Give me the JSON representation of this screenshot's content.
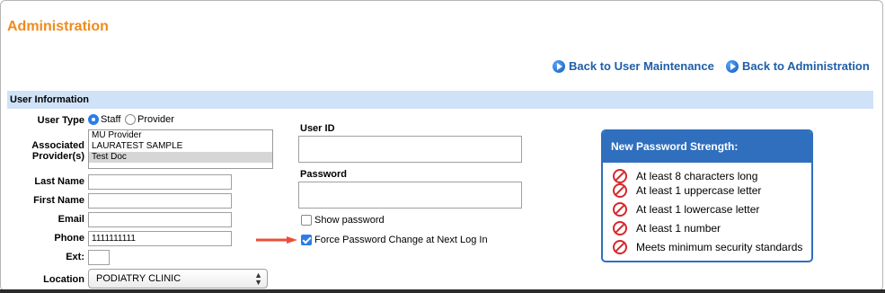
{
  "page": {
    "title": "Administration"
  },
  "nav": {
    "back_user_maintenance": "Back to User Maintenance",
    "back_administration": "Back to Administration"
  },
  "section": {
    "title": "User Information"
  },
  "form": {
    "user_type_label": "User Type",
    "user_type_options": [
      "Staff",
      "Provider"
    ],
    "user_type_selected": "Staff",
    "associated_providers_label": "Associated Provider(s)",
    "associated_providers": [
      "MU Provider",
      "LAURATEST SAMPLE",
      "Test Doc"
    ],
    "associated_provider_selected": "Test Doc",
    "last_name_label": "Last Name",
    "last_name_value": "",
    "first_name_label": "First Name",
    "first_name_value": "",
    "email_label": "Email",
    "email_value": "",
    "phone_label": "Phone",
    "phone_value": "1111111111",
    "ext_label": "Ext:",
    "ext_value": "",
    "location_label": "Location",
    "location_value": "PODIATRY CLINIC",
    "user_id_label": "User ID",
    "user_id_value": "",
    "password_label": "Password",
    "password_value": "",
    "show_password_label": "Show password",
    "show_password_checked": false,
    "force_change_label": "Force Password Change at Next Log In",
    "force_change_checked": true
  },
  "password_strength": {
    "title": "New Password Strength:",
    "rules": [
      "At least 8 characters long",
      "At least 1 uppercase letter",
      "At least 1 lowercase letter",
      "At least 1 number",
      "Meets minimum security standards"
    ],
    "status_icon": "prohibited-icon",
    "status_color": "#d7262b"
  },
  "colors": {
    "title": "#f08a1c",
    "link": "#1f5fa8",
    "section_bar": "#cfe2f7",
    "accent": "#2f6fbd",
    "annotation_arrow": "#e8503a"
  },
  "icons": {
    "nav_link": "circle-arrow-right-icon",
    "annotation": "red-arrow-icon"
  }
}
